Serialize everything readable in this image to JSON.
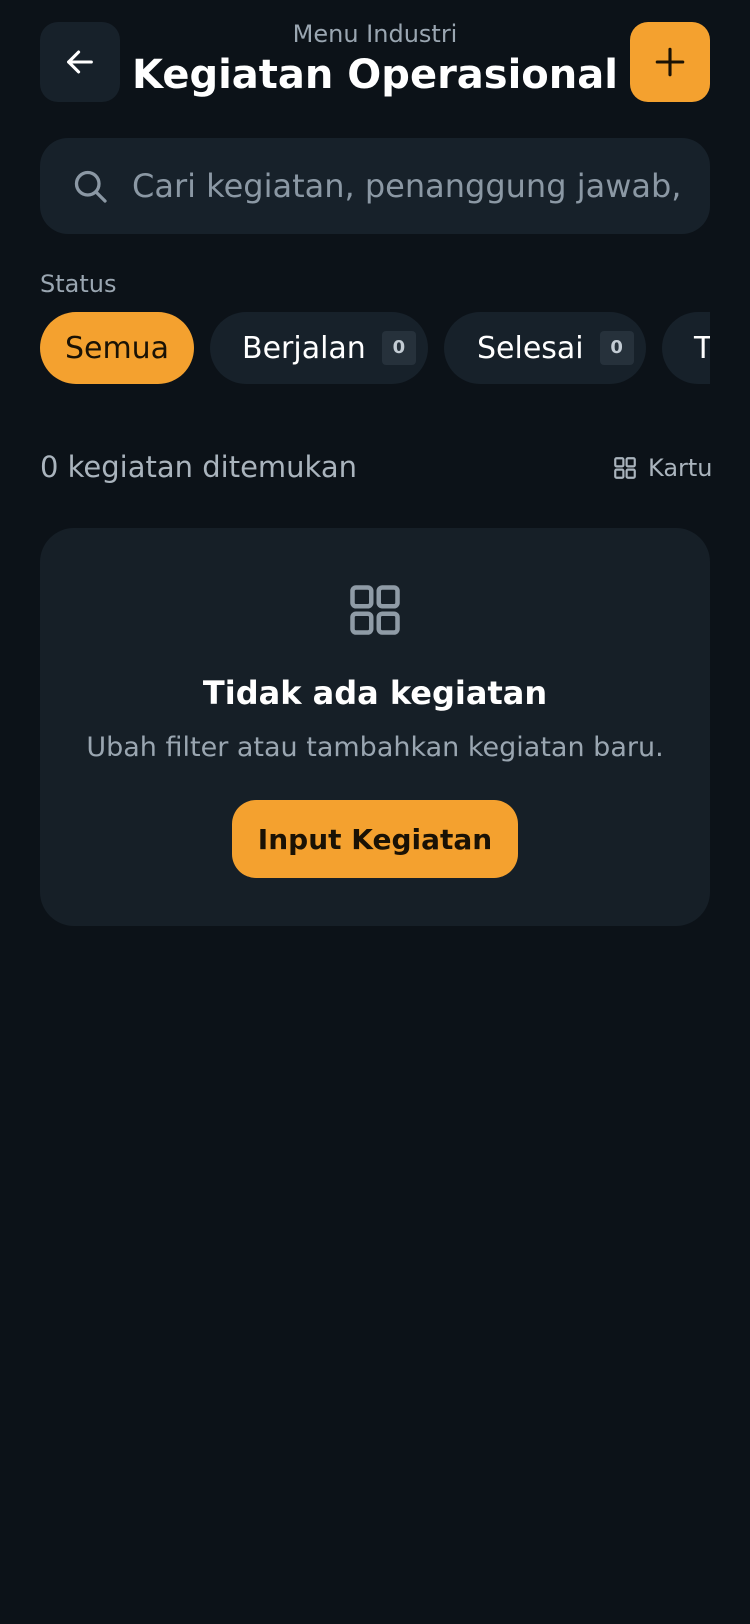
{
  "header": {
    "subtitle": "Menu Industri",
    "title": "Kegiatan Operasional"
  },
  "search": {
    "placeholder": "Cari kegiatan, penanggung jawab, mo"
  },
  "filters": {
    "label": "Status",
    "chips": [
      {
        "label": "Semua",
        "count": null,
        "active": true
      },
      {
        "label": "Berjalan",
        "count": "0",
        "active": false
      },
      {
        "label": "Selesai",
        "count": "0",
        "active": false
      },
      {
        "label": "T",
        "count": null,
        "active": false
      }
    ]
  },
  "results": {
    "count_text": "0 kegiatan ditemukan",
    "view_label": "Kartu"
  },
  "empty_state": {
    "title": "Tidak ada kegiatan",
    "description": "Ubah filter atau tambahkan kegiatan baru.",
    "button_label": "Input Kegiatan"
  },
  "colors": {
    "background": "#0c1218",
    "surface": "#17212a",
    "accent": "#f4a12f"
  },
  "icons": {
    "back": "arrow-left-icon",
    "add": "plus-icon",
    "search": "search-icon",
    "view": "grid-icon",
    "empty": "grid-icon"
  }
}
